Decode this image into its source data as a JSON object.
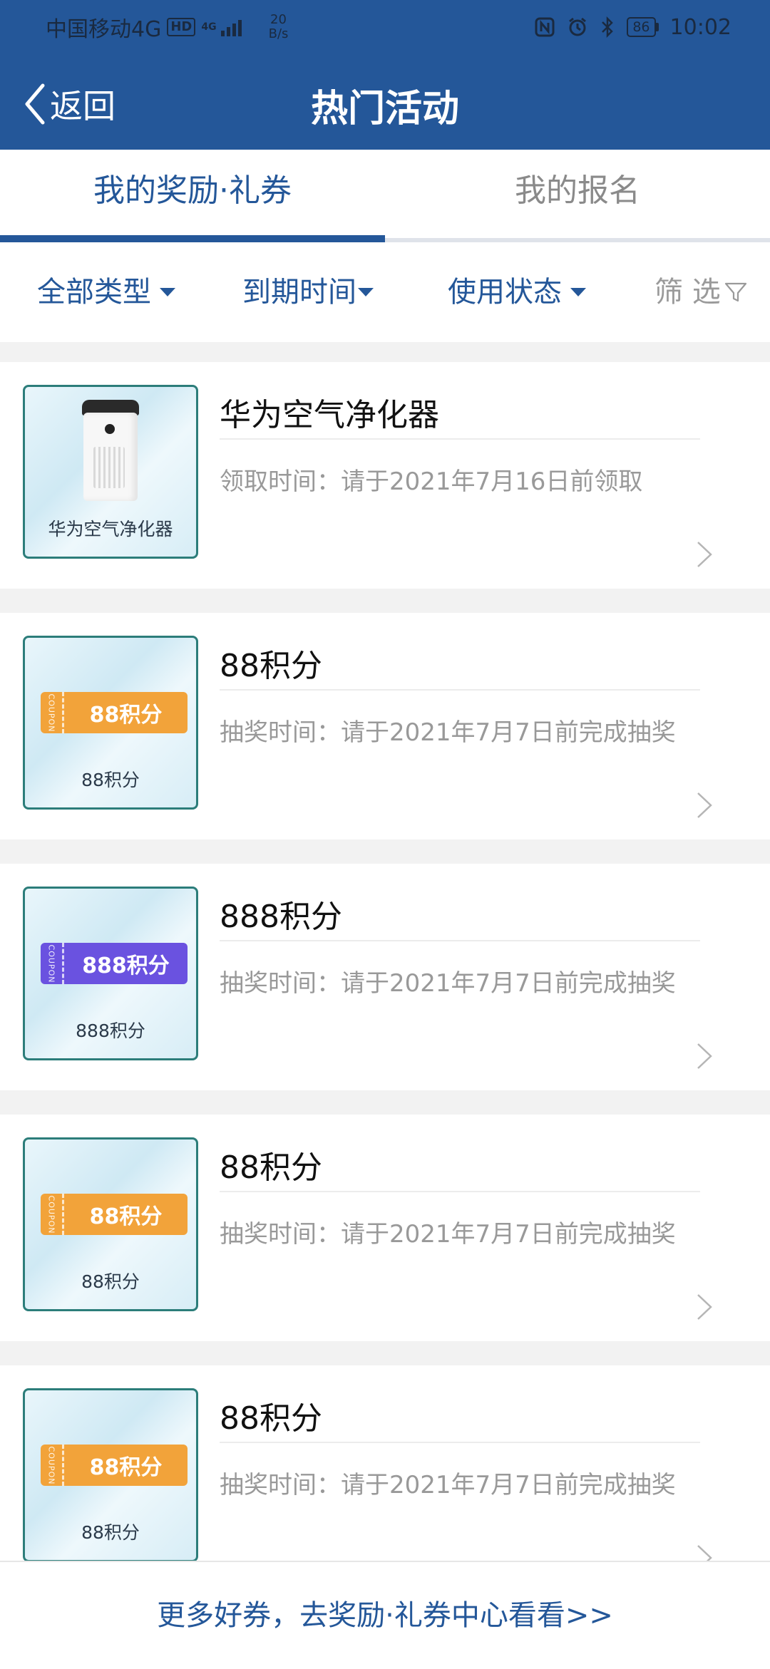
{
  "status_bar": {
    "carrier": "中国移动4G",
    "hd": "HD",
    "signal_type": "4G",
    "speed_value": "20",
    "speed_unit": "B/s",
    "battery": "86",
    "time": "10:02"
  },
  "header": {
    "back_label": "返回",
    "title": "热门活动"
  },
  "tabs": [
    {
      "label": "我的奖励·礼券",
      "active": true
    },
    {
      "label": "我的报名",
      "active": false
    }
  ],
  "filters": {
    "type": "全部类型",
    "expiry": "到期时间",
    "usage": "使用状态",
    "screen": "筛 选"
  },
  "rewards": [
    {
      "thumb_label": "华为空气净化器",
      "title": "华为空气净化器",
      "subtitle": "领取时间：请于2021年7月16日前领取",
      "kind": "product"
    },
    {
      "thumb_label": "88积分",
      "coupon_text": "88积分",
      "coupon_tag": "COUPON",
      "title": "88积分",
      "subtitle": "抽奖时间：请于2021年7月7日前完成抽奖",
      "kind": "coupon",
      "color": "#f2a33a"
    },
    {
      "thumb_label": "888积分",
      "coupon_text": "888积分",
      "coupon_tag": "COUPON",
      "title": "888积分",
      "subtitle": "抽奖时间：请于2021年7月7日前完成抽奖",
      "kind": "coupon",
      "color": "#6a52e0"
    },
    {
      "thumb_label": "88积分",
      "coupon_text": "88积分",
      "coupon_tag": "COUPON",
      "title": "88积分",
      "subtitle": "抽奖时间：请于2021年7月7日前完成抽奖",
      "kind": "coupon",
      "color": "#f2a33a"
    },
    {
      "thumb_label": "88积分",
      "coupon_text": "88积分",
      "coupon_tag": "COUPON",
      "title": "88积分",
      "subtitle": "抽奖时间：请于2021年7月7日前完成抽奖",
      "kind": "coupon",
      "color": "#f2a33a"
    }
  ],
  "footer": {
    "link": "更多好券，去奖励·礼券中心看看>>"
  },
  "colors": {
    "primary": "#245799",
    "muted": "#999999",
    "coupon_orange": "#f2a33a",
    "coupon_purple": "#6a52e0"
  },
  "icons": [
    "back-chevron-icon",
    "filter-funnel-icon",
    "chevron-right-icon",
    "nfc-icon",
    "alarm-icon",
    "bluetooth-icon",
    "battery-icon"
  ]
}
